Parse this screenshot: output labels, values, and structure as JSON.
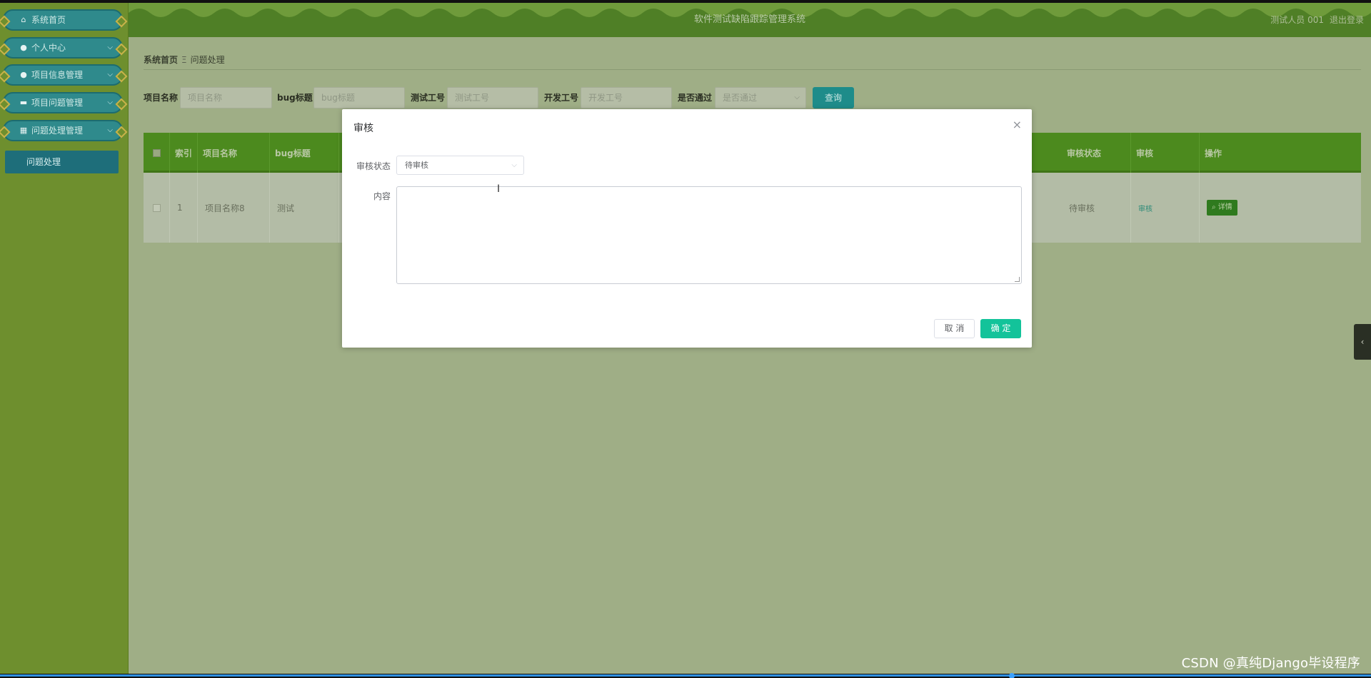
{
  "app": {
    "title": "软件测试缺陷跟踪管理系统"
  },
  "header": {
    "user": "测试人员 001",
    "logout": "退出登录"
  },
  "sidebar": {
    "items": [
      {
        "label": "系统首页",
        "icon": "home-icon",
        "glyph": "⌂"
      },
      {
        "label": "个人中心",
        "icon": "user-icon",
        "glyph": "●",
        "chevron": "⌵"
      },
      {
        "label": "项目信息管理",
        "icon": "user-icon",
        "glyph": "●",
        "chevron": "⌵"
      },
      {
        "label": "项目问题管理",
        "icon": "monitor-icon",
        "glyph": "▬",
        "chevron": "⌵"
      },
      {
        "label": "问题处理管理",
        "icon": "grid-icon",
        "glyph": "▦",
        "chevron": "⌵"
      }
    ],
    "active_sub": "问题处理"
  },
  "breadcrumb": {
    "home": "系统首页",
    "sep": "Ξ",
    "current": "问题处理"
  },
  "search": {
    "project_name_label": "项目名称",
    "project_name_placeholder": "项目名称",
    "bug_title_label": "bug标题",
    "bug_title_placeholder": "bug标题",
    "tester_id_label": "测试工号",
    "tester_id_placeholder": "测试工号",
    "dev_id_label": "开发工号",
    "dev_id_placeholder": "开发工号",
    "passed_label": "是否通过",
    "passed_placeholder": "是否通过",
    "query_button": "查询"
  },
  "table": {
    "headers": {
      "index": "索引",
      "project_name": "项目名称",
      "bug_title": "bug标题",
      "review_status": "审核状态",
      "review": "审核",
      "action": "操作"
    },
    "rows": [
      {
        "index": "1",
        "project_name": "项目名称8",
        "bug_title": "测试",
        "review_status": "待审核",
        "review": "审核",
        "action": "详情"
      }
    ]
  },
  "dialog": {
    "title": "审核",
    "close": "×",
    "status_label": "审核状态",
    "status_value": "待审核",
    "content_label": "内容",
    "content_value": "",
    "cancel": "取 消",
    "confirm": "确 定"
  },
  "watermark": "CSDN @真纯Django毕设程序",
  "colors": {
    "accent": "#13c39a",
    "header": "#4f7f26",
    "sidebar": "#6e8f2e",
    "table_head": "#4c8a1e",
    "menu": "#2f8a8c"
  }
}
